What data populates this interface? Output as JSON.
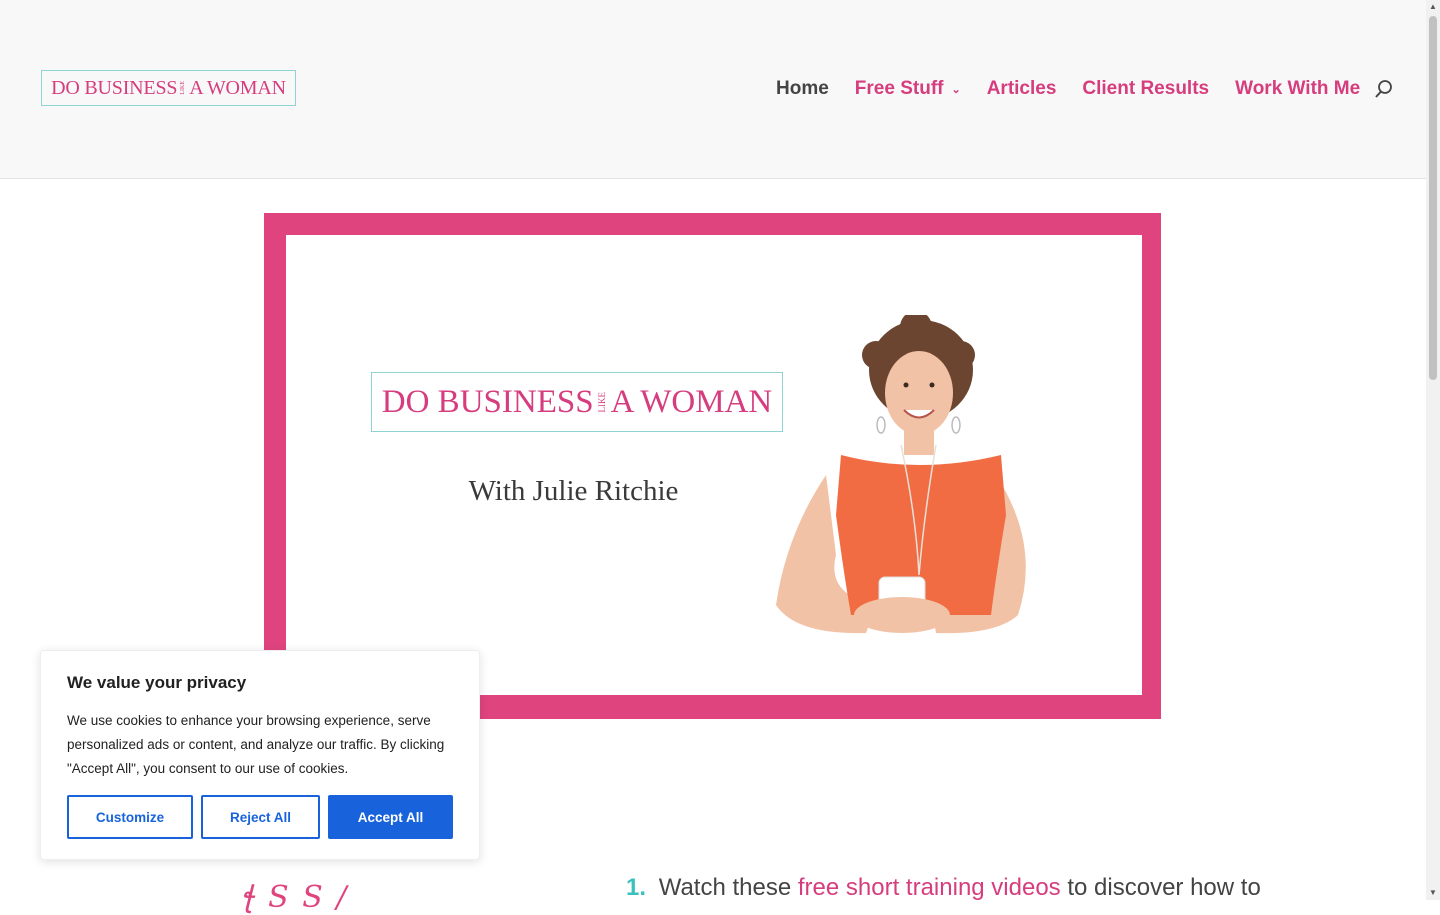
{
  "header": {
    "logo": {
      "left": "DO BUSINESS",
      "small": "LIKE",
      "right": "A WOMAN"
    },
    "nav": [
      {
        "label": "Home",
        "active": true
      },
      {
        "label": "Free Stuff",
        "has_dropdown": true
      },
      {
        "label": "Articles"
      },
      {
        "label": "Client Results"
      },
      {
        "label": "Work With Me"
      }
    ],
    "search_icon": "search-icon"
  },
  "hero": {
    "logo": {
      "left": "DO BUSINESS",
      "small": "LIKE",
      "right": "A WOMAN"
    },
    "tagline": "With Julie Ritchie"
  },
  "cookie": {
    "title": "We value your privacy",
    "text": "We use cookies to enhance your browsing experience, serve personalized ads or content, and analyze our traffic. By clicking \"Accept All\", you consent to our use of cookies.",
    "customize_label": "Customize",
    "reject_label": "Reject All",
    "accept_label": "Accept All"
  },
  "content": {
    "step_number": "1.",
    "step_prefix": "Watch these",
    "step_link": "free short training videos",
    "step_suffix": "to discover how to"
  },
  "colors": {
    "brand_pink": "#e0447f",
    "brand_teal": "#8fd3d3",
    "accent_blue": "#1863dc"
  }
}
